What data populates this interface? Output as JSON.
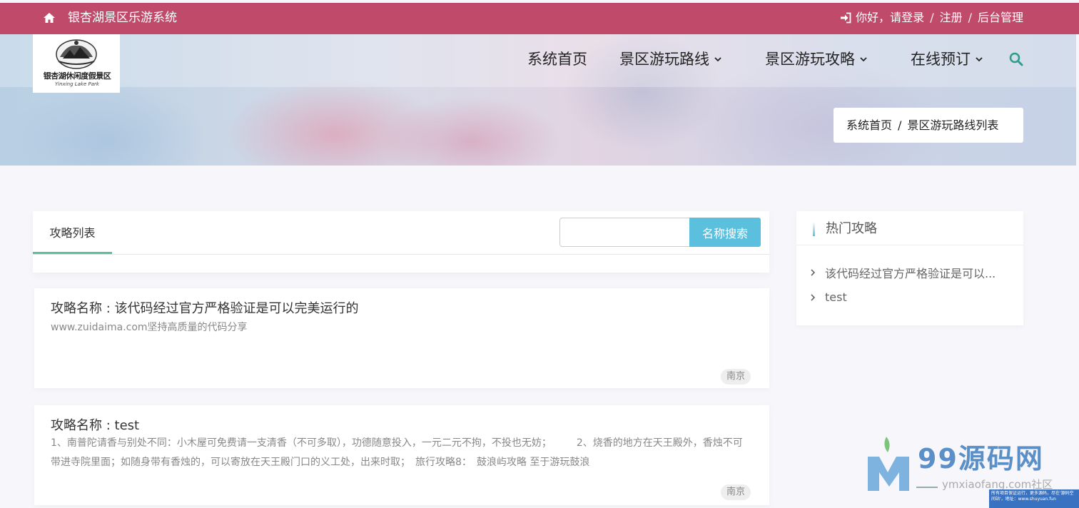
{
  "topbar": {
    "site_name": "银杏湖景区乐游系统",
    "login": "你好，请登录",
    "sep": "/",
    "register": "注册",
    "admin": "后台管理"
  },
  "logo": {
    "text": "银杏湖休闲度假景区",
    "sub": "Yinxing Lake Park"
  },
  "nav": {
    "home": "系统首页",
    "routes": "景区游玩路线",
    "guides": "景区游玩攻略",
    "booking": "在线预订"
  },
  "breadcrumb": {
    "home": "系统首页",
    "sep": "/",
    "current": "景区游玩路线列表"
  },
  "list": {
    "tab": "攻略列表",
    "search_placeholder": "",
    "search_button": "名称搜索"
  },
  "cards": [
    {
      "title": "攻略名称 : 该代码经过官方严格验证是可以完美运行的",
      "desc": "www.zuidaima.com坚持高质量的代码分享",
      "tag": "南京"
    },
    {
      "title": "攻略名称 : test",
      "desc": "1、南普陀请香与别处不同：小木屋可免费请一支清香（不可多取），功德随意投入，一元二元不拘，不投也无妨；　　　2、烧香的地方在天王殿外，香烛不可带进寺院里面；如随身带有香烛的，可以寄放在天王殿门口的义工处，出来时取；　旅行攻略8：　鼓浪屿攻略 至于游玩鼓浪",
      "tag": "南京"
    }
  ],
  "sidebar": {
    "title": "热门攻略",
    "items": [
      {
        "label": "该代码经过官方严格验证是可以..."
      },
      {
        "label": "test"
      }
    ]
  },
  "watermark": {
    "brand": "99源码网",
    "url": "ymxiaofang.com社区",
    "notice": "所有项目保证运行，更多源码，尽在'源码空间站'，地址：www.shuyuan.fun"
  },
  "colors": {
    "topbar": "#c04a6a",
    "accent": "#5bc0de",
    "tab_underline": "#5bbfa0"
  }
}
